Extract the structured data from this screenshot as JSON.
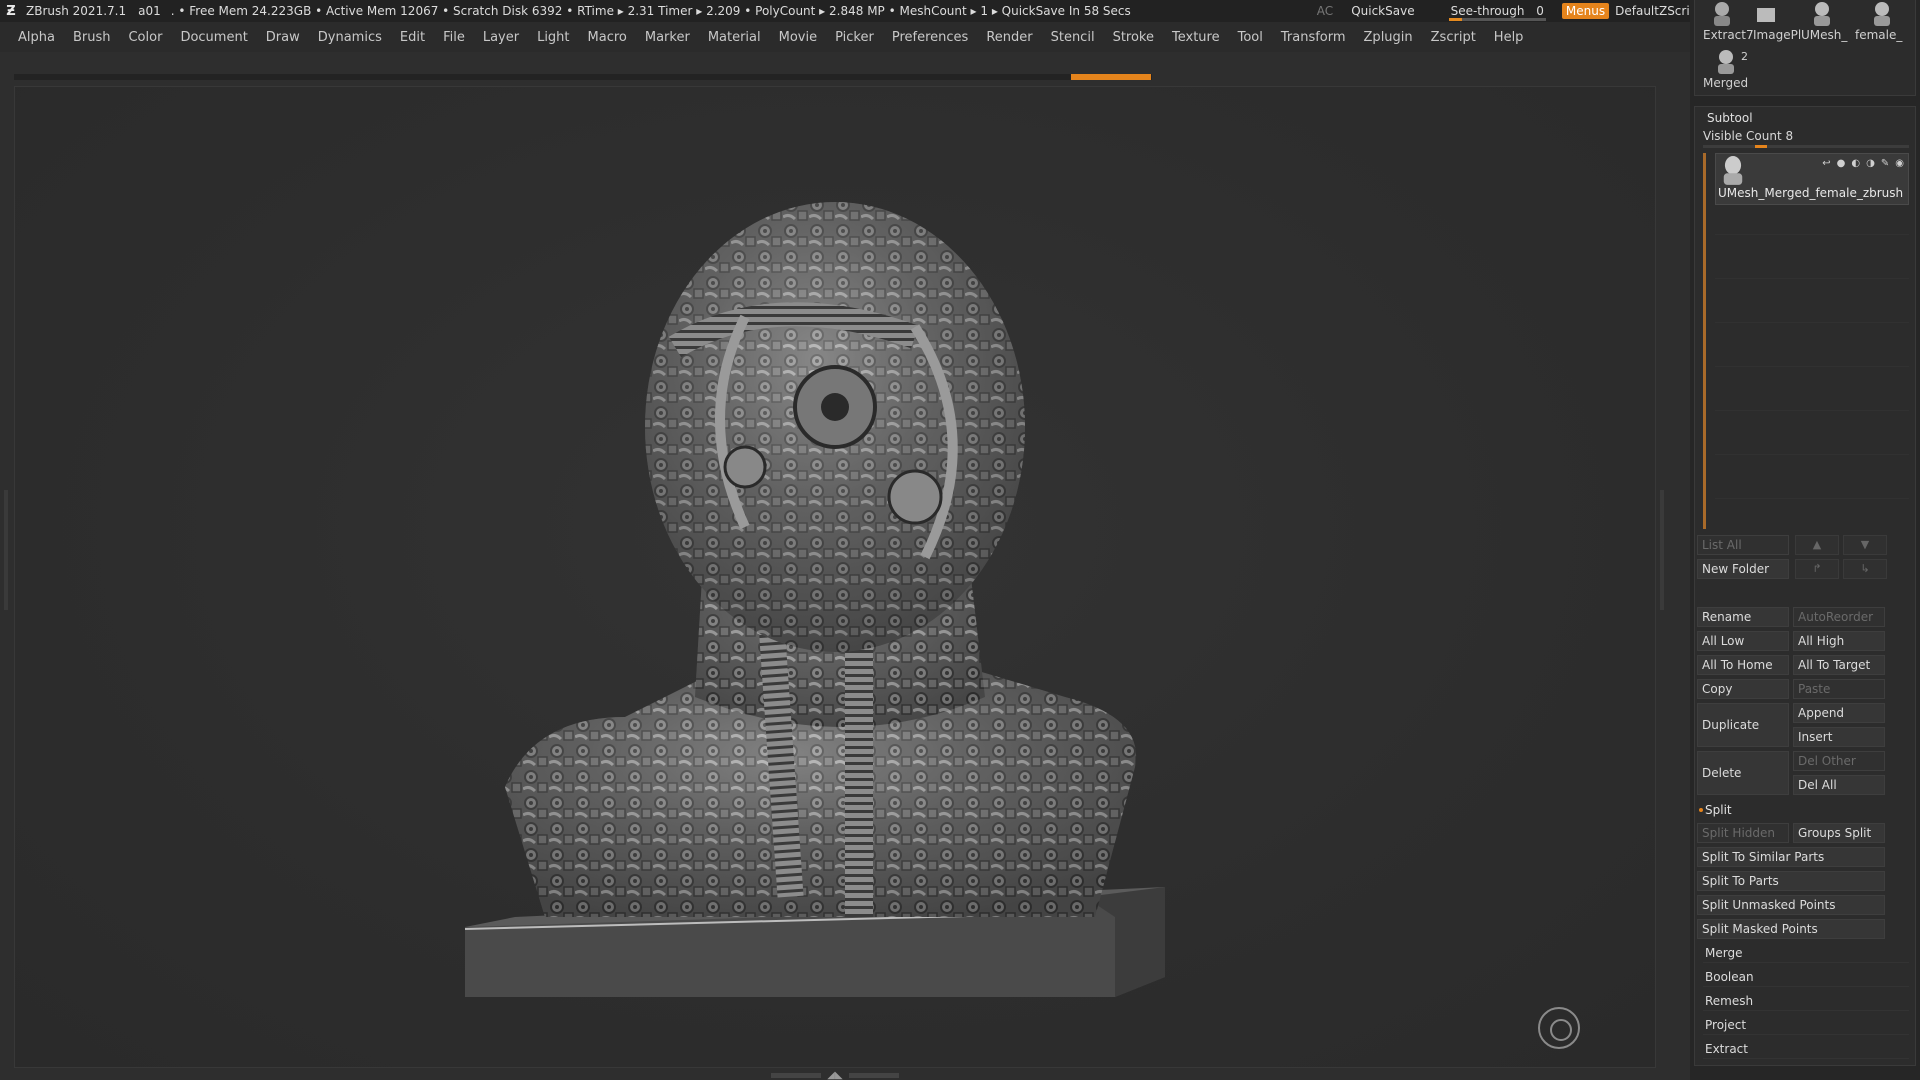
{
  "titlebar": {
    "app": "ZBrush 2021.7.1",
    "doc": "a01",
    "stats": ". • Free Mem 24.223GB • Active Mem 12067 • Scratch Disk 6392 •  RTime ▸ 2.31 Timer ▸ 2.209 • PolyCount ▸ 2.848 MP  • MeshCount ▸ 1  ▸ QuickSave In 58 Secs",
    "ac": "AC",
    "quicksave": "QuickSave",
    "see_through_label": "See-through",
    "see_through_value": "0",
    "menus": "Menus",
    "script": "DefaultZScript"
  },
  "menu": [
    "Alpha",
    "Brush",
    "Color",
    "Document",
    "Draw",
    "Dynamics",
    "Edit",
    "File",
    "Layer",
    "Light",
    "Macro",
    "Marker",
    "Material",
    "Movie",
    "Picker",
    "Preferences",
    "Render",
    "Stencil",
    "Stroke",
    "Texture",
    "Tool",
    "Transform",
    "Zplugin",
    "Zscript",
    "Help"
  ],
  "tool_thumbs": {
    "labels": [
      "Extract7",
      "ImagePl",
      "UMesh_",
      "female_"
    ],
    "merged_count": "2",
    "merged_label": "Merged"
  },
  "subtool": {
    "title": "Subtool",
    "visible_count": "Visible Count 8",
    "item_name": "UMesh_Merged_female_zbrush",
    "list_all": "List All",
    "new_folder": "New Folder",
    "rename": "Rename",
    "autoreorder": "AutoReorder",
    "all_low": "All Low",
    "all_high": "All High",
    "all_to_home": "All To Home",
    "all_to_target": "All To Target",
    "copy": "Copy",
    "paste": "Paste",
    "duplicate": "Duplicate",
    "append": "Append",
    "insert": "Insert",
    "delete": "Delete",
    "del_other": "Del Other",
    "del_all": "Del All",
    "split": "Split",
    "split_hidden": "Split Hidden",
    "groups_split": "Groups Split",
    "split_similar": "Split To Similar Parts",
    "split_parts": "Split To Parts",
    "split_unmasked": "Split Unmasked Points",
    "split_masked": "Split Masked Points",
    "merge": "Merge",
    "boolean": "Boolean",
    "remesh": "Remesh",
    "project": "Project",
    "extract": "Extract"
  },
  "colors": {
    "accent": "#e5841c",
    "bg": "#2e2e2e",
    "panel": "#2c2c2c"
  }
}
